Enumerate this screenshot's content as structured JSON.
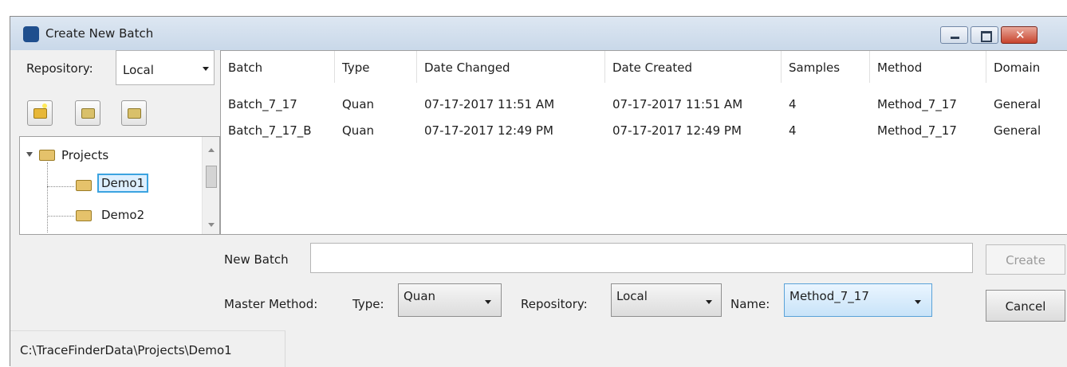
{
  "window": {
    "title": "Create New Batch"
  },
  "left": {
    "repository_label": "Repository:",
    "repository_value": "Local",
    "tree": {
      "root": "Projects",
      "children": [
        "Demo1",
        "Demo2"
      ]
    }
  },
  "table": {
    "columns": [
      "Batch",
      "Type",
      "Date Changed",
      "Date Created",
      "Samples",
      "Method",
      "Domain"
    ],
    "rows": [
      [
        "Batch_7_17",
        "Quan",
        "07-17-2017 11:51 AM",
        "07-17-2017 11:51 AM",
        "4",
        "Method_7_17",
        "General"
      ],
      [
        "Batch_7_17_B",
        "Quan",
        "07-17-2017 12:49 PM",
        "07-17-2017 12:49 PM",
        "4",
        "Method_7_17",
        "General"
      ]
    ]
  },
  "form": {
    "new_batch_label": "New Batch",
    "new_batch_value": "",
    "create_label": "Create",
    "master_method_label": "Master Method:",
    "type_label": "Type:",
    "type_value": "Quan",
    "repository_label": "Repository:",
    "repository_value": "Local",
    "name_label": "Name:",
    "name_value": "Method_7_17",
    "cancel_label": "Cancel"
  },
  "status": {
    "path": "C:\\TraceFinderData\\Projects\\Demo1"
  }
}
